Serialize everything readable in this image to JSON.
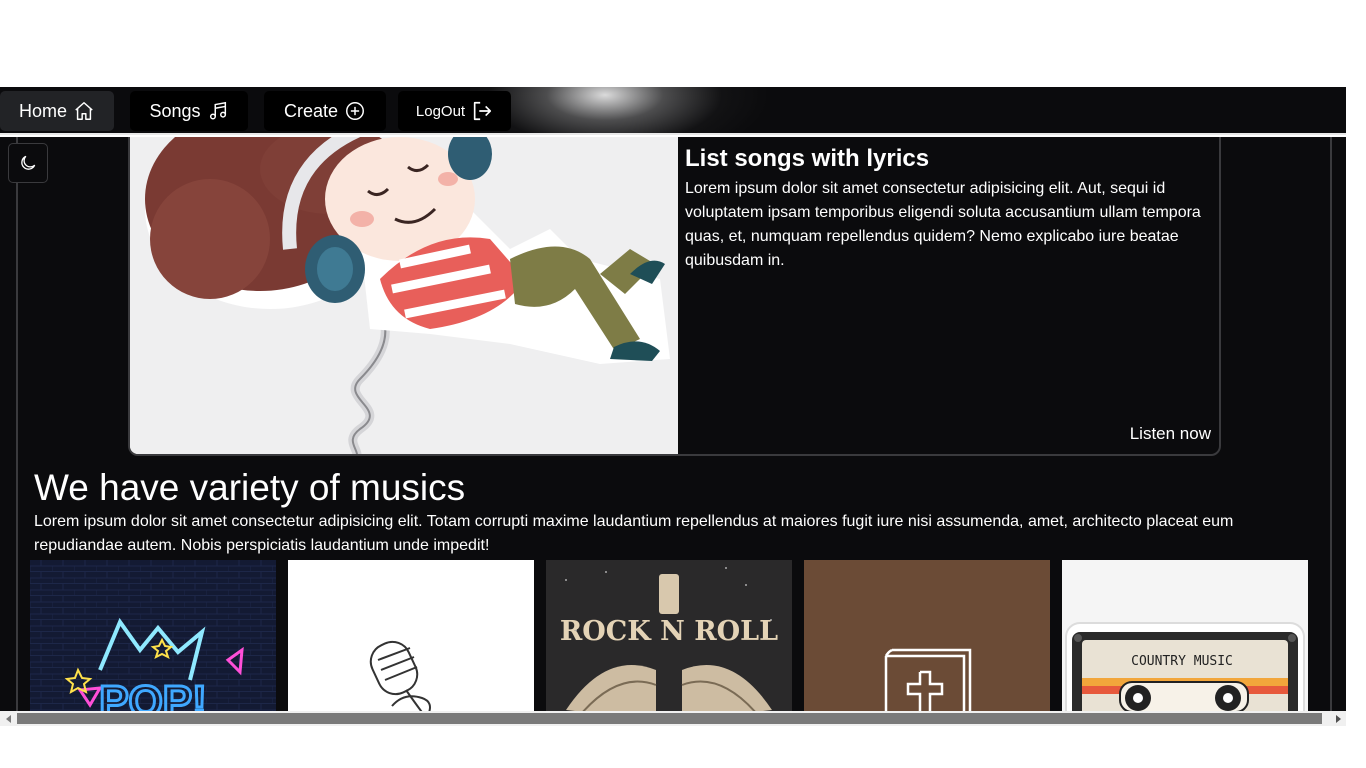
{
  "nav": {
    "home_label": "Home",
    "songs_label": "Songs",
    "create_label": "Create",
    "logout_label": "LogOut"
  },
  "hero": {
    "title": "List songs with lyrics",
    "text": "Lorem ipsum dolor sit amet consectetur adipisicing elit. Aut, sequi id voluptatem ipsam temporibus eligendi soluta accusantium ullam tempora quas, et, numquam repellendus quidem? Nemo explicabo iure beatae quibusdam in.",
    "cta_label": "Listen now"
  },
  "section": {
    "title": "We have variety of musics",
    "text": "Lorem ipsum dolor sit amet consectetur adipisicing elit. Totam corrupti maxime laudantium repellendus at maiores fugit iure nisi assumenda, amet, architecto placeat eum repudiandae autem. Nobis perspiciatis laudantium unde impedit!"
  },
  "cards": [
    {
      "name": "pop",
      "art_text": "POP!"
    },
    {
      "name": "microphone"
    },
    {
      "name": "rock-n-roll",
      "art_text": "ROCK N ROLL"
    },
    {
      "name": "gospel"
    },
    {
      "name": "country",
      "art_text": "COUNTRY MUSIC"
    }
  ],
  "colors": {
    "background": "#0b0b0d",
    "border": "#3a3a3d",
    "text": "#ffffff"
  },
  "icons": {
    "home": "home-icon",
    "songs": "music-note-icon",
    "create": "plus-circle-icon",
    "logout": "logout-icon",
    "theme": "moon-icon"
  }
}
